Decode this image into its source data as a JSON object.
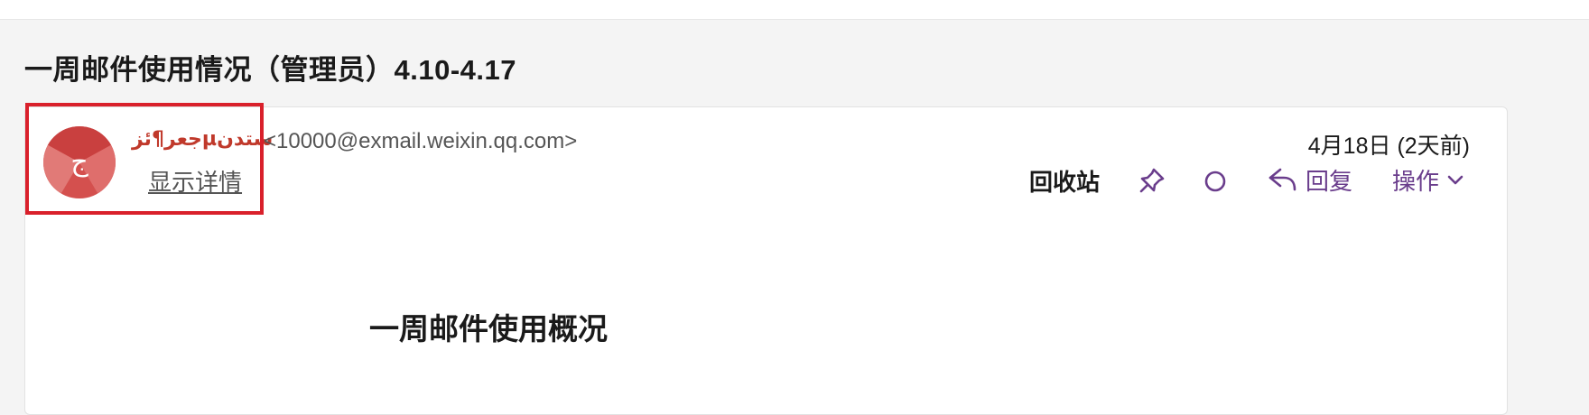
{
  "mail": {
    "subject": "一周邮件使用情况（管理员）4.10-4.17",
    "sender": {
      "avatar_letter": "ج",
      "name": "ستدنµجعر¶ئز",
      "email": "<10000@exmail.weixin.qq.com>",
      "show_details_label": "显示详情"
    },
    "date": "4月18日 (2天前)",
    "folder_label": "回收站",
    "toolbar": {
      "pin_icon": "pin-icon",
      "circle_icon": "circle-icon",
      "reply_label": "回复",
      "actions_label": "操作"
    },
    "body": {
      "heading": "一周邮件使用概况"
    }
  },
  "colors": {
    "accent": "#6a3d8c",
    "highlight_border": "#d9202b",
    "avatar_bg": "#d4504e",
    "sender_name": "#c0392b"
  }
}
